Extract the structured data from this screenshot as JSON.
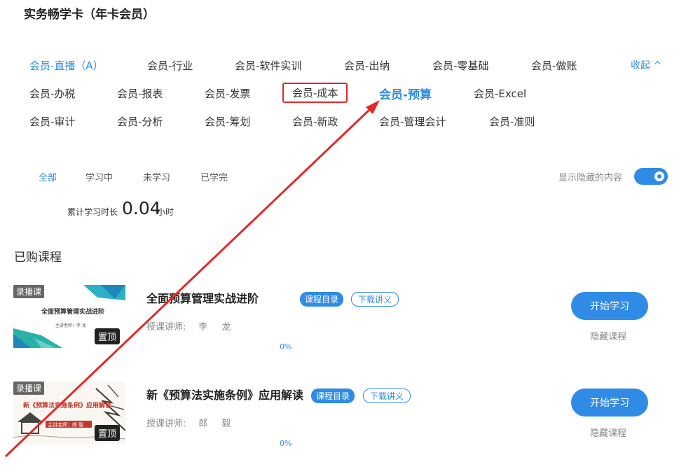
{
  "header": {
    "title": "实务畅学卡（年卡会员）"
  },
  "categories": {
    "row1": [
      "会员-直播（A）",
      "会员-行业",
      "会员-软件实训",
      "会员-出纳",
      "会员-零基础",
      "会员-做账"
    ],
    "row2": [
      "会员-办税",
      "会员-报表",
      "会员-发票",
      "会员-成本",
      "会员-预算",
      "会员-Excel"
    ],
    "row3": [
      "会员-审计",
      "会员-分析",
      "会员-筹划",
      "会员-新政",
      "会员-管理会计",
      "会员-准则"
    ],
    "collapse_label": "收起 ^"
  },
  "filters": {
    "tabs": [
      "全部",
      "学习中",
      "未学习",
      "已学完"
    ],
    "show_hidden_label": "显示隐藏的内容",
    "show_hidden_on": true
  },
  "stats": {
    "label": "累计学习时长",
    "value": "0.04",
    "unit": "小时"
  },
  "section_title": "已购课程",
  "courses": [
    {
      "badge": "录播课",
      "thumb_caption": "全面预算管理实战进阶",
      "thumb_teacher": "主讲老师：李 龙",
      "pin_label": "置顶",
      "title": "全面预算管理实战进阶",
      "catalog_label": "课程目录",
      "download_label": "下载讲义",
      "teacher_label": "授课讲师:",
      "teacher_name": "李 龙",
      "progress": "0%",
      "start_label": "开始学习",
      "hide_label": "隐藏课程"
    },
    {
      "badge": "录播课",
      "thumb_caption": "新《预算法实施条例》应用解读",
      "thumb_teacher": "主讲老师：郎 毅",
      "pin_label": "置顶",
      "title": "新《预算法实施条例》应用解读",
      "catalog_label": "课程目录",
      "download_label": "下载讲义",
      "teacher_label": "授课讲师:",
      "teacher_name": "郎 毅",
      "progress": "0%",
      "start_label": "开始学习",
      "hide_label": "隐藏课程"
    }
  ],
  "colors": {
    "accent": "#2f8be6",
    "annotation": "#e12a2a"
  }
}
